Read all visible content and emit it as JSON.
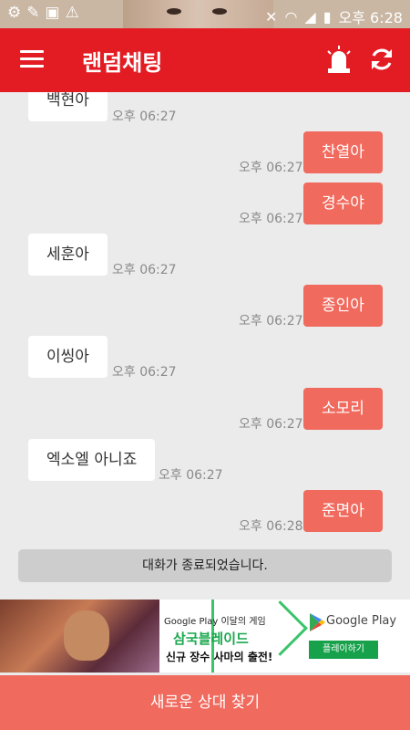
{
  "status_bar": {
    "time": "오후 6:28",
    "icons": [
      "settings-icon",
      "wrench-icon",
      "image-icon",
      "warning-icon",
      "mute-icon",
      "wifi-icon",
      "signal-icon",
      "battery-icon"
    ]
  },
  "app_bar": {
    "title": "랜덤채팅",
    "background": "#e31c24",
    "icons": [
      "menu-icon",
      "siren-icon",
      "refresh-icon"
    ]
  },
  "messages": [
    {
      "side": "in",
      "text": "백현아",
      "time": "오후 06:27"
    },
    {
      "side": "out",
      "text": "찬열아",
      "time": "오후 06:27"
    },
    {
      "side": "out",
      "text": "경수야",
      "time": "오후 06:27"
    },
    {
      "side": "in",
      "text": "세훈아",
      "time": "오후 06:27"
    },
    {
      "side": "out",
      "text": "종인아",
      "time": "오후 06:27"
    },
    {
      "side": "in",
      "text": "이씽아",
      "time": "오후 06:27"
    },
    {
      "side": "out",
      "text": "소모리",
      "time": "오후 06:27"
    },
    {
      "side": "in",
      "text": "엑소엘 아니죠",
      "time": "오후 06:27"
    },
    {
      "side": "out",
      "text": "준면아",
      "time": "오후 06:28"
    }
  ],
  "conversation_ended": "대화가 종료되었습니다.",
  "ad": {
    "promo": "Google Play 이달의 게임",
    "game_title": "삼국블레이드",
    "subtitle": "신규 장수 사마의 출전!",
    "store": "Google Play",
    "button": "플레이하기",
    "accent": "#16a14a"
  },
  "bottom_button": {
    "label": "새로운 상대 찾기",
    "color": "#f06a5e"
  }
}
